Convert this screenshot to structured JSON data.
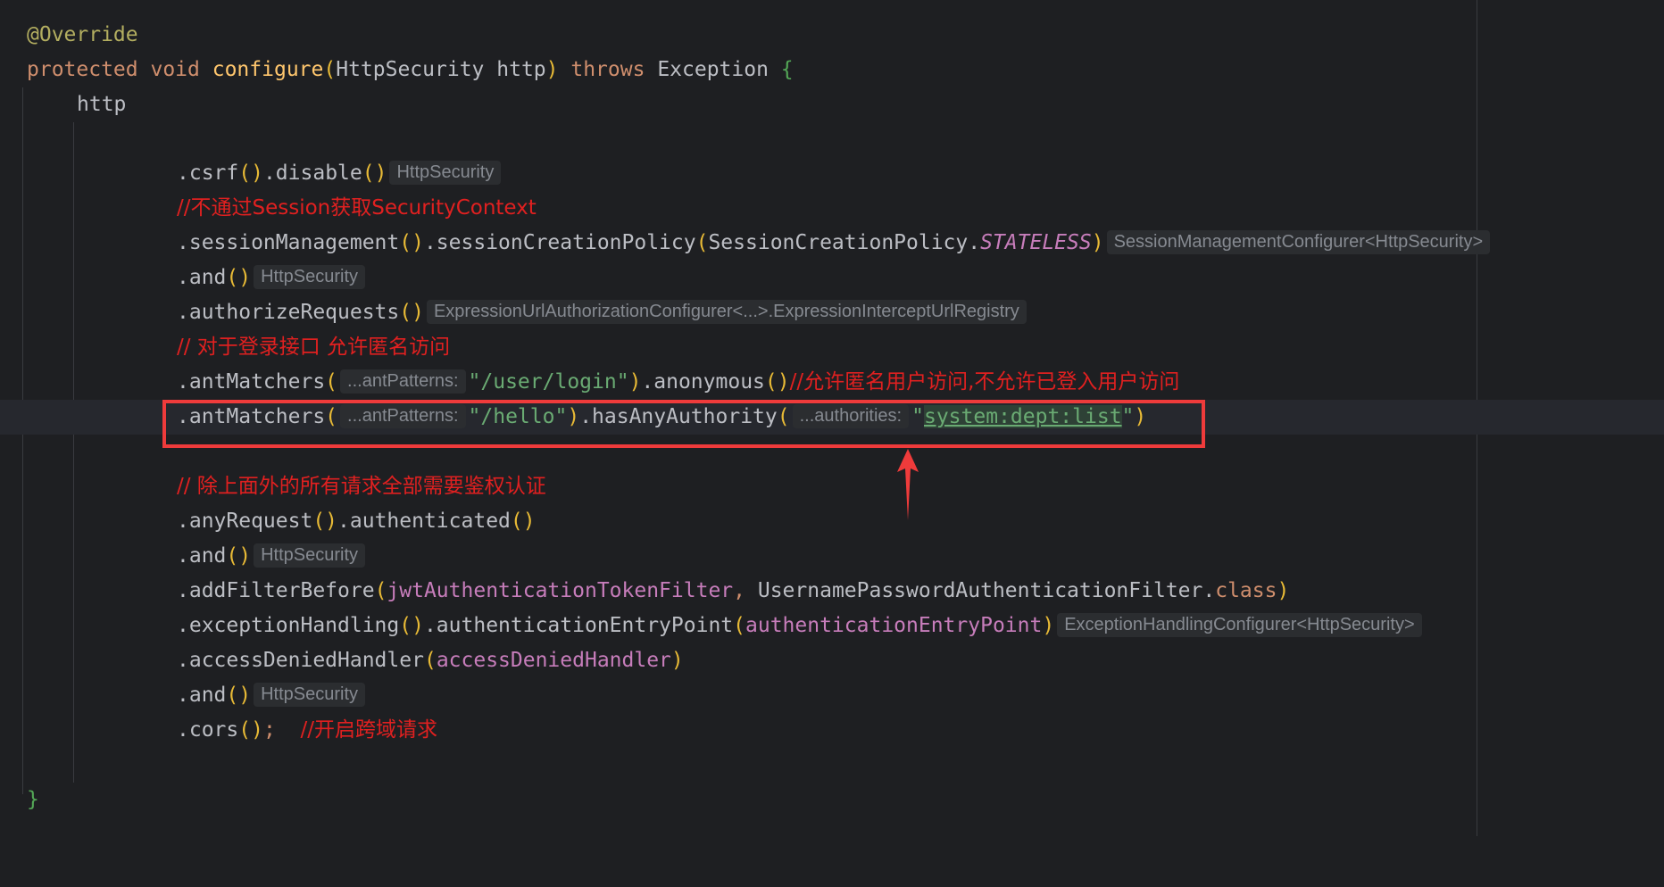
{
  "editor": {
    "override": "@Override",
    "kw_protected": "protected",
    "kw_void": "void",
    "method_name": "configure",
    "param_type": "HttpSecurity",
    "param_name": "http",
    "kw_throws": "throws",
    "exception_type": "Exception",
    "open_brace": "{",
    "close_brace": "}",
    "http": "http",
    "csrf": ".csrf",
    "disable": ".disable",
    "hint_httpsecurity": "HttpSecurity",
    "comment_session": "//不通过Session获取SecurityContext",
    "session_management": ".sessionManagement",
    "session_creation_policy": ".sessionCreationPolicy",
    "session_policy_class": "SessionCreationPolicy.",
    "stateless": "STATELESS",
    "hint_session_configurer": "SessionManagementConfigurer<HttpSecurity>",
    "and": ".and",
    "authorize_requests": ".authorizeRequests",
    "hint_registry": "ExpressionUrlAuthorizationConfigurer<...>.ExpressionInterceptUrlRegistry",
    "comment_login": "// 对于登录接口 允许匿名访问",
    "ant_matchers": ".antMatchers",
    "hint_ant_patterns": "...antPatterns:",
    "str_login": "\"/user/login\"",
    "anonymous": ".anonymous",
    "comment_anonymous": "//允许匿名用户访问,不允许已登入用户访问",
    "str_hello": "\"/hello\"",
    "has_any_authority": ".hasAnyAuthority",
    "hint_authorities": "...authorities:",
    "quote": "\"",
    "authority_value": "system:dept:list",
    "comment_auth": "// 除上面外的所有请求全部需要鉴权认证",
    "any_request": ".anyRequest",
    "authenticated": ".authenticated",
    "add_filter_before": ".addFilterBefore",
    "jwt_filter": "jwtAuthenticationTokenFilter",
    "comma": ", ",
    "upaf_class": "UsernamePasswordAuthenticationFilter.",
    "kw_class": "class",
    "exception_handling": ".exceptionHandling",
    "auth_entry_point_method": ".authenticationEntryPoint",
    "auth_entry_point_field": "authenticationEntryPoint",
    "hint_exception_configurer": "ExceptionHandlingConfigurer<HttpSecurity>",
    "access_denied_method": ".accessDeniedHandler",
    "access_denied_field": "accessDeniedHandler",
    "cors": ".cors",
    "semicolon": ";",
    "comment_cors": "//开启跨域请求"
  },
  "colors": {
    "background": "#1e1f22",
    "current_line": "#26282e",
    "annotation_box": "#ef3b3b",
    "comment": "#e02020"
  }
}
